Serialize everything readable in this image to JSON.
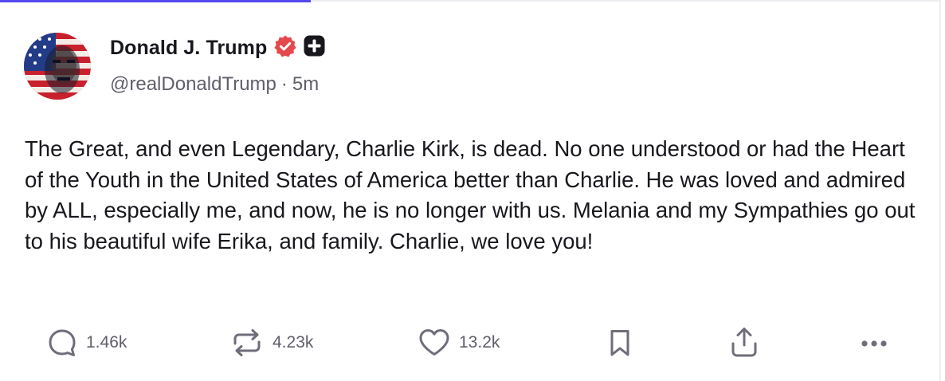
{
  "post": {
    "author_name": "Donald J. Trump",
    "handle": "@realDonaldTrump",
    "separator": "·",
    "time_ago": "5m",
    "text": "The Great, and even Legendary, Charlie Kirk, is dead. No one understood or had the Heart of the Youth in the United States of America better than Charlie. He was loved and admired by ALL, especially me, and now, he is no longer with us. Melania and my Sympathies go out to his beautiful wife Erika, and family. Charlie, we love you!"
  },
  "actions": {
    "replies": {
      "count": "1.46k",
      "icon": "reply-icon"
    },
    "retruths": {
      "count": "4.23k",
      "icon": "retruth-icon"
    },
    "likes": {
      "count": "13.2k",
      "icon": "heart-icon"
    },
    "bookmark": {
      "icon": "bookmark-icon"
    },
    "share": {
      "icon": "share-icon"
    },
    "more": {
      "icon": "more-icon"
    }
  },
  "colors": {
    "accent": "#5448ee",
    "verified_badge": "#e5484d",
    "text": "#17171d",
    "muted": "#5f5f6b",
    "icon": "#6e6e7a"
  }
}
